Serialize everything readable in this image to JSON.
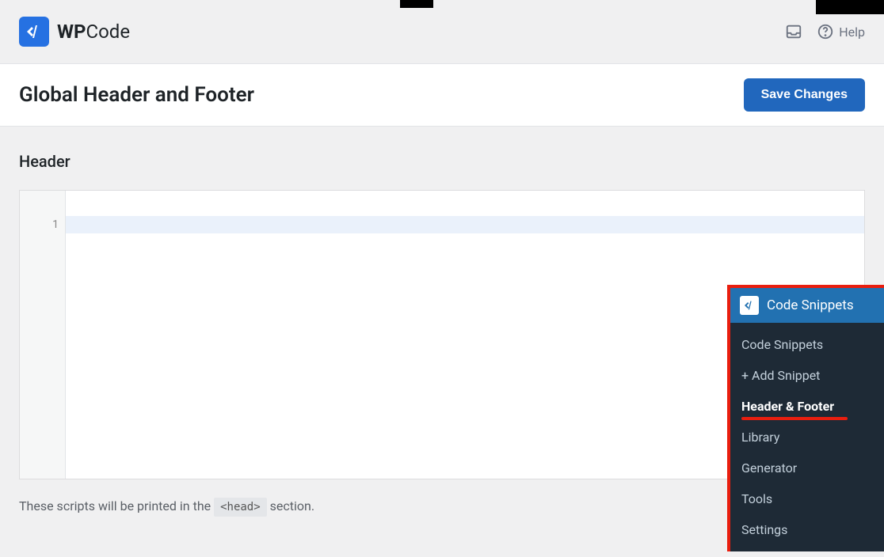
{
  "brand": {
    "bold": "WP",
    "rest": "Code"
  },
  "topbar": {
    "help": "Help"
  },
  "page": {
    "title": "Global Header and Footer",
    "save": "Save Changes"
  },
  "section": {
    "title": "Header"
  },
  "editor": {
    "line1": "1",
    "value": ""
  },
  "footer": {
    "prefix": "These scripts will be printed in the ",
    "code": "<head>",
    "suffix": " section."
  },
  "sidebar": {
    "title": "Code Snippets",
    "items": [
      {
        "label": "Code Snippets",
        "active": false
      },
      {
        "label": "+ Add Snippet",
        "active": false
      },
      {
        "label": "Header & Footer",
        "active": true
      },
      {
        "label": "Library",
        "active": false
      },
      {
        "label": "Generator",
        "active": false
      },
      {
        "label": "Tools",
        "active": false
      },
      {
        "label": "Settings",
        "active": false
      }
    ]
  }
}
